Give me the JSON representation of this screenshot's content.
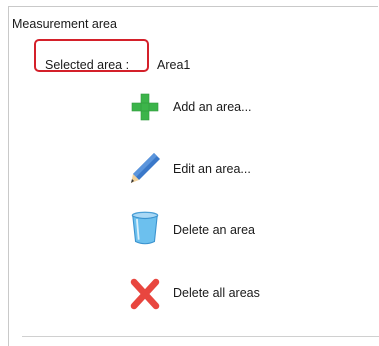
{
  "panel": {
    "title": "Measurement area",
    "selected_label": "Selected area :",
    "selected_value": "Area1"
  },
  "actions": [
    {
      "label": "Add an area...",
      "icon": "plus-icon",
      "color": "#3cb44a"
    },
    {
      "label": "Edit an area...",
      "icon": "pencil-icon",
      "color": "#3a78c9"
    },
    {
      "label": "Delete an area",
      "icon": "trash-icon",
      "color": "#5fb3e6"
    },
    {
      "label": "Delete all areas",
      "icon": "close-x-icon",
      "color": "#e8463f"
    }
  ],
  "colors": {
    "highlight_border": "#d4202a"
  }
}
